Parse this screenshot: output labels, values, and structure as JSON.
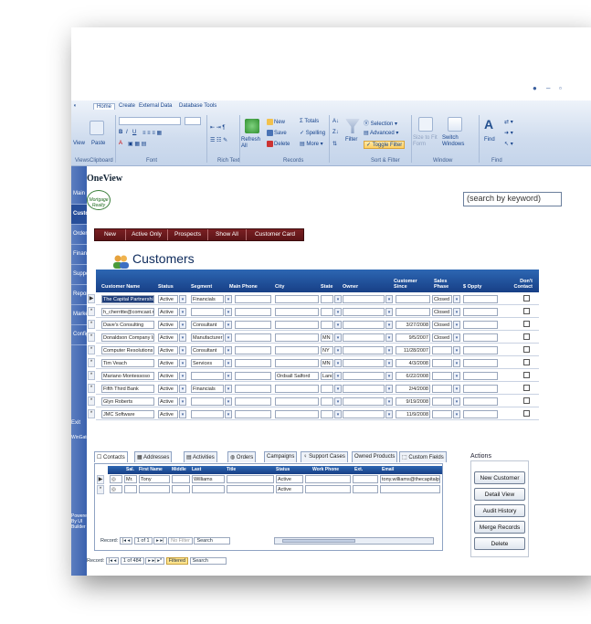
{
  "ribbon": {
    "tabs": [
      "Home",
      "Create",
      "External Data",
      "Database Tools"
    ],
    "groups": [
      "Views",
      "Clipboard",
      "Font",
      "Rich Text",
      "Records",
      "Sort & Filter",
      "Window",
      "Find"
    ],
    "view_label": "View",
    "paste_label": "Paste",
    "records": {
      "new": "New",
      "save": "Save",
      "delete": "Delete",
      "totals": "Totals",
      "spelling": "Spelling",
      "more": "More",
      "refresh": "Refresh All"
    },
    "sort_filter": {
      "filter": "Filter",
      "selection": "Selection",
      "advanced": "Advanced",
      "toggle": "Toggle Filter"
    },
    "window": {
      "size_to_fit": "Size to Fit Form",
      "switch": "Switch Windows"
    },
    "find": {
      "find": "Find"
    }
  },
  "nav": {
    "items": [
      "Main Menu",
      "Customers",
      "Orders",
      "Financials",
      "Support",
      "Reports",
      "Marketing",
      "Configure"
    ],
    "active_index": 1,
    "bottom_items": [
      "Exit",
      "WinGate Software"
    ],
    "powered_by": "Powered By UI Builder"
  },
  "header": {
    "app_title": "OneView",
    "search_placeholder": "(search by keyword)",
    "logo_text": "Mortgage Realty",
    "toolbar": [
      "New",
      "Active Only",
      "Prospects",
      "Show All",
      "Customer Card"
    ]
  },
  "customers": {
    "title": "Customers",
    "columns": [
      "Customer Name",
      "Status",
      "Segment",
      "Main Phone",
      "City",
      "State",
      "Owner",
      "Customer Since",
      "Sales Phase",
      "$ Oppty",
      "Don't Contact"
    ],
    "rows": [
      {
        "name": "The Capital Partnership",
        "status": "Active",
        "segment": "Financials",
        "city": "",
        "state": "",
        "since": "",
        "phase": "Closed"
      },
      {
        "name": "h_cherritte@comcast.net",
        "status": "Active",
        "segment": "",
        "city": "",
        "state": "",
        "since": "",
        "phase": "Closed"
      },
      {
        "name": "Dave's Consulting",
        "status": "Active",
        "segment": "Consultant",
        "city": "",
        "state": "",
        "since": "3/27/2008",
        "phase": "Closed"
      },
      {
        "name": "Donaldson Company Inc",
        "status": "Active",
        "segment": "Manufacturer",
        "city": "",
        "state": "MN",
        "since": "9/5/2007",
        "phase": "Closed"
      },
      {
        "name": "Computer Resolutions Inc",
        "status": "Active",
        "segment": "Consultant",
        "city": "",
        "state": "NY",
        "since": "11/28/2007",
        "phase": ""
      },
      {
        "name": "Tim Veach",
        "status": "Active",
        "segment": "Services",
        "city": "",
        "state": "MN",
        "since": "4/3/2008",
        "phase": ""
      },
      {
        "name": "Mariano Montessoso",
        "status": "Active",
        "segment": "",
        "city": "Ordsall Salford",
        "state": "Lancs",
        "since": "6/22/2008",
        "phase": ""
      },
      {
        "name": "Fifth Third Bank",
        "status": "Active",
        "segment": "Financials",
        "city": "",
        "state": "",
        "since": "2/4/2008",
        "phase": ""
      },
      {
        "name": "Glyn Roberts",
        "status": "Active",
        "segment": "",
        "city": "",
        "state": "",
        "since": "9/19/2008",
        "phase": ""
      },
      {
        "name": "JMC Software",
        "status": "Active",
        "segment": "",
        "city": "",
        "state": "",
        "since": "11/9/2008",
        "phase": ""
      }
    ]
  },
  "subtabs": [
    "Contacts",
    "Addresses",
    "Activities",
    "Orders",
    "Campaigns",
    "Support Cases",
    "Owned Products",
    "Custom Fields"
  ],
  "contacts": {
    "columns": [
      "Sal.",
      "First Name",
      "Middle",
      "Last",
      "Title",
      "Status",
      "Work Phone",
      "Ext.",
      "Email"
    ],
    "rows": [
      {
        "sal": "Mr.",
        "first": "Tony",
        "last": "Williams",
        "status": "Active",
        "email": "tony.williams@thecapitalpa"
      },
      {
        "sal": "",
        "first": "",
        "last": "",
        "status": "Active",
        "email": ""
      }
    ],
    "record_nav": {
      "label": "Record:",
      "position": "1 of 1",
      "filter": "No Filter",
      "search": "Search"
    }
  },
  "main_record_nav": {
    "label": "Record:",
    "position": "1 of 484",
    "filter": "Filtered",
    "search": "Search"
  },
  "actions": {
    "title": "Actions",
    "buttons": [
      "New Customer",
      "Detail View",
      "Audit History",
      "Merge Records",
      "Delete"
    ]
  },
  "colors": {
    "nav_blue": "#3b62ae",
    "header_blue": "#1f4c96",
    "toolbar_maroon": "#6b1a1d",
    "ribbon": "#cfdcee"
  }
}
